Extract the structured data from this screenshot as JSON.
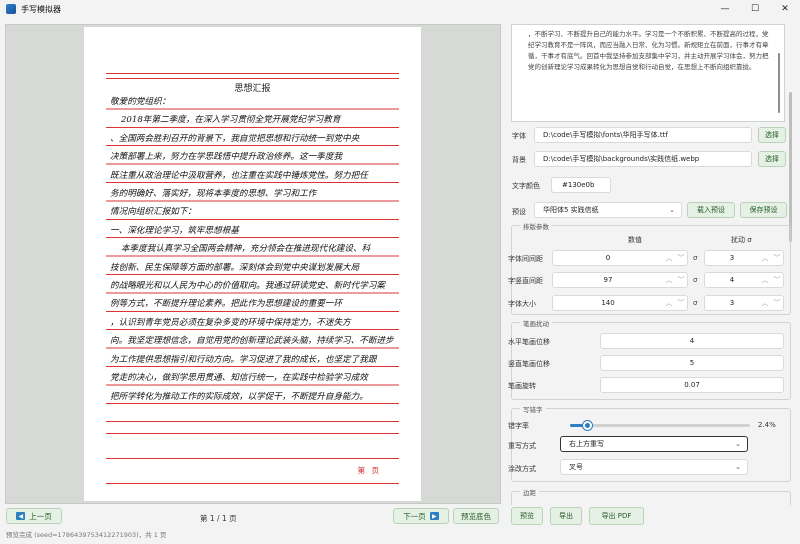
{
  "window": {
    "title": "手写模拟器",
    "controls": {
      "minimize": "—",
      "maximize": "☐",
      "close": "✕"
    }
  },
  "preview": {
    "paper_title": "思想汇报",
    "body_lines": [
      "敬爱的党组织：",
      "    2018年第二季度，在深入学习贯彻全党开展党纪学习教育",
      "、全国两会胜利召开的背景下，我自觉把思想和行动统一到党中央",
      "决策部署上来，努力在学思践悟中提升政治修养。这一季度我",
      "既注重从政治理论中汲取营养，也注重在实践中锤炼党性。努力把任",
      "务的明确好、落实好，现将本季度的思想、学习和工作",
      "情况向组织汇报如下：",
      "一、深化理论学习，筑牢思想根基",
      "    本季度我认真学习全国两会精神，充分领会在推进现代化建设、科",
      "技创新、民生保障等方面的部署。深刻体会到党中央谋划发展大局",
      "的战略眼光和以人民为中心的价值取向。我通过研读党史、新时代学习案",
      "例等方式，不断提升理论素养。把此作为思想建设的重要一环",
      "，认识到青年党员必须在复杂多变的环境中保持定力，不迷失方",
      "向。我坚定理想信念，自觉用党的创新理论武装头脑，持续学习、不断进步",
      "为工作提供思想指引和行动方向。学习促进了我的成长，也坚定了我跟",
      "党走的决心，做到学思用贯通、知信行统一，在实践中检验学习成效",
      "把所学转化为推动工作的实际成效，以学促干，不断提升自身能力。"
    ],
    "page_footer": "第   页"
  },
  "bottom_bar": {
    "prev_label": "上一页",
    "page_indicator": "第 1 / 1 页",
    "next_label": "下一页",
    "bg_color_label": "预览底色",
    "status_text": "预览完成 (seed=1786439753412271903)，共 1 页"
  },
  "editor": {
    "text_preview": "，不断学习、不断提升自己的能力水平。学习是一个不断积累、不断提高的过程，党纪学习教育不是一阵风，而应当融入日常、化为习惯。新规矩立在前面，行事才有章循，干事才有底气。回首中我坚持参加支部集中学习，并主动开展学习体会，努力把党的创新理论学习成果转化为思想自觉和行动自觉，在思想上不断向组织靠拢。"
  },
  "settings": {
    "font_label": "字体",
    "font_path": "D:\\code\\手写模拟\\fonts\\华阳手写体.ttf",
    "font_btn": "选择",
    "bg_label": "背景",
    "bg_path": "D:\\code\\手写模拟\\backgrounds\\实践信纸.webp",
    "bg_btn": "选择",
    "color_label": "文字颜色",
    "color_value": "#130e0b",
    "preset_label": "预设",
    "preset_value": "华阳体5 实践信纸",
    "load_preset_btn": "载入预设",
    "save_preset_btn": "保存预设"
  },
  "layout_group": {
    "title": "排版参数",
    "col_value": "数值",
    "col_jitter": "扰动 σ",
    "rows": [
      {
        "label": "字体间间距",
        "value": "0",
        "sigma": "σ",
        "jitter": "3"
      },
      {
        "label": "字竖直间距",
        "value": "97",
        "sigma": "σ",
        "jitter": "4"
      },
      {
        "label": "字体大小",
        "value": "140",
        "sigma": "σ",
        "jitter": "3"
      }
    ]
  },
  "stroke_group": {
    "title": "笔画扰动",
    "rows": [
      {
        "label": "水平笔画位移",
        "value": "4"
      },
      {
        "label": "竖直笔画位移",
        "value": "5"
      },
      {
        "label": "笔画旋转",
        "value": "0.07"
      }
    ]
  },
  "typo_group": {
    "title": "写错字",
    "rate_label": "错字率",
    "rate_value": 0.024,
    "rate_text": "2.4%",
    "mode_label": "重写方式",
    "mode_value": "右上方重写",
    "erase_label": "涂改方式",
    "erase_value": "叉号"
  },
  "margin_group": {
    "title": "边距"
  },
  "actions": {
    "preview_btn": "预览",
    "export_btn": "导出",
    "export_pdf_btn": "导出 PDF"
  },
  "colors": {
    "accent": "#2d7fc1",
    "button_bg": "#e6f1e6",
    "ruled_line": "#dd3333"
  }
}
